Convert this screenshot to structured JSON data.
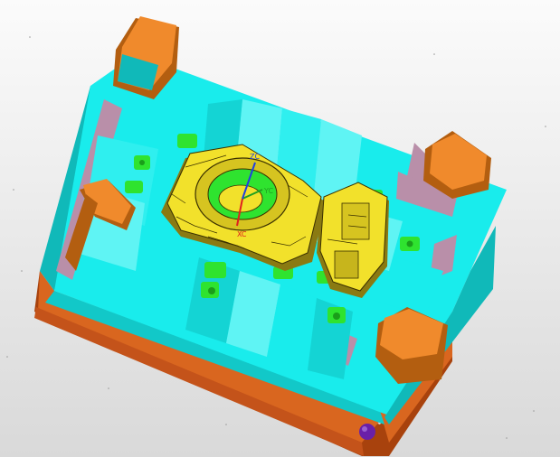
{
  "viewport": {
    "background_top": "#fbfbfb",
    "background_bottom": "#d9d9d9"
  },
  "model": {
    "base_plate_color": "#d9661f",
    "base_plate_shadow": "#a8420d",
    "mold_plate_color": "#19ecec",
    "mold_plate_shadow": "#10b9b9",
    "mold_plate_highlight": "#b9fbfb",
    "corner_blocks_color": "#f08a2c",
    "corner_blocks_shadow": "#b35e10",
    "wall_color": "#b98fa9",
    "slider_color": "#2fe32f",
    "slider_shadow": "#1a9e1a",
    "part_color": "#f2e12b",
    "part_shadow": "#8a7a12",
    "part_outline": "#3a3000",
    "knob_color": "#6a20a8"
  },
  "axis_triad": {
    "x_label": "XC",
    "y_label": "YC",
    "z_label": "ZC",
    "x_color": "#e02020",
    "y_color": "#20a020",
    "z_color": "#2040e0"
  }
}
